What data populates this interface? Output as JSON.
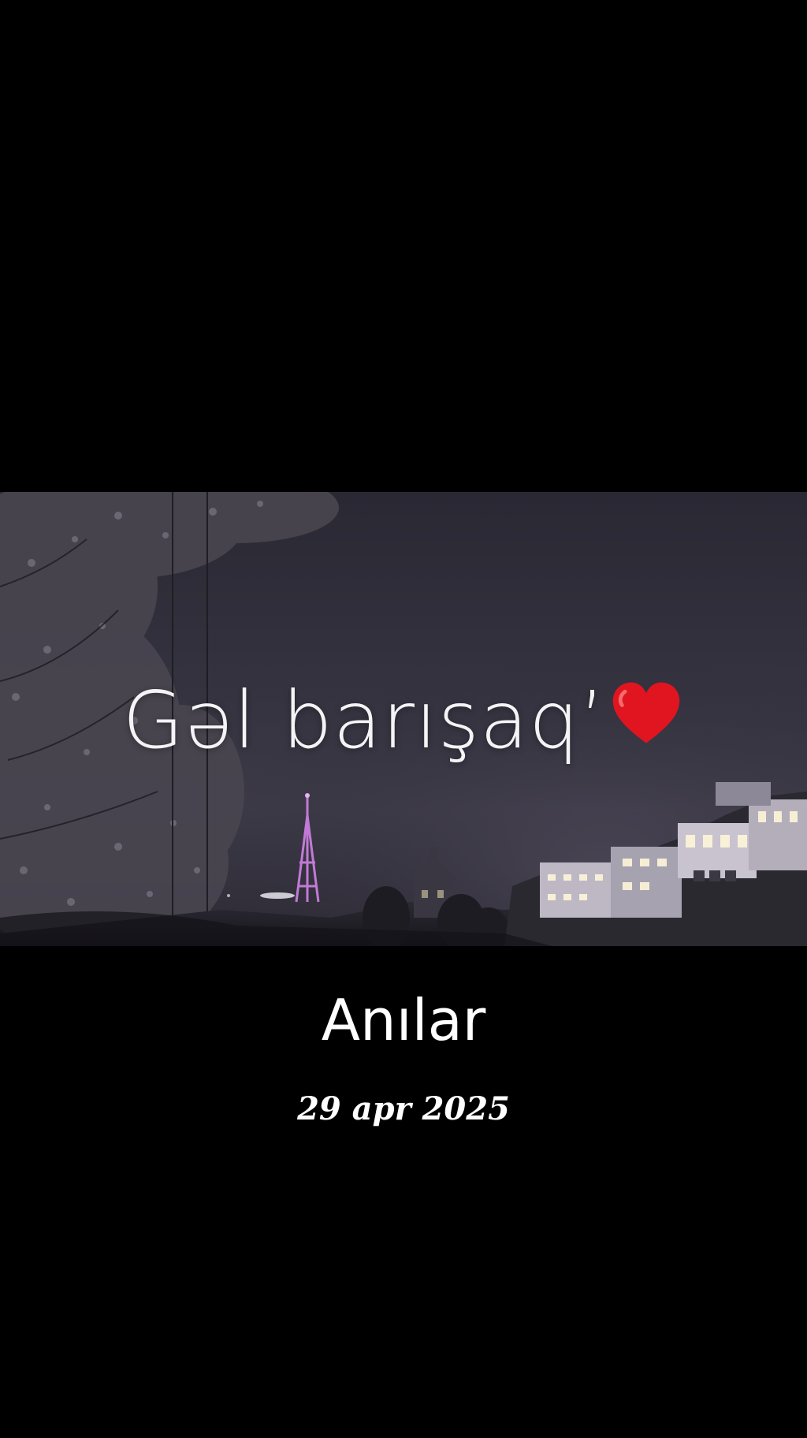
{
  "video": {
    "caption": "Gəl barışaq’",
    "caption_emoji": "red-heart-emoji"
  },
  "album": {
    "title": "Anılar",
    "date": "29 apr 2025"
  },
  "colors": {
    "background": "#000000",
    "text": "#ffffff",
    "heart": "#e0151f",
    "tower_light": "#c27ad6"
  }
}
